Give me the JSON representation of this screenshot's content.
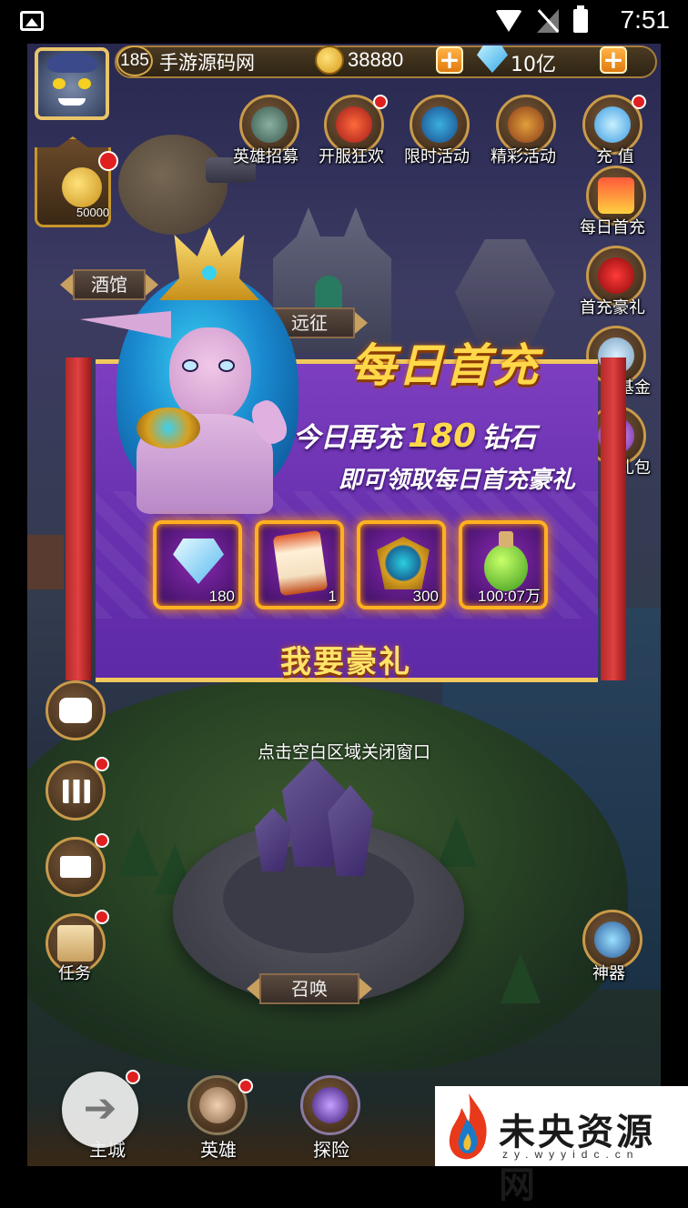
{
  "status_bar": {
    "time": "7:51",
    "icons": [
      "image-icon",
      "wifi-icon",
      "no-sim-icon",
      "battery-icon"
    ]
  },
  "player": {
    "level": "185",
    "name": "手游源码网",
    "gold": "38880",
    "diamonds": "10亿"
  },
  "top_menu": [
    {
      "label": "英雄招募",
      "icon": "hero-recruit-icon"
    },
    {
      "label": "开服狂欢",
      "icon": "server-carnival-icon"
    },
    {
      "label": "限时活动",
      "icon": "limited-event-icon"
    },
    {
      "label": "精彩活动",
      "icon": "featured-event-icon"
    },
    {
      "label": "充 值",
      "icon": "recharge-icon"
    }
  ],
  "right_menu": [
    {
      "label": "每日首充"
    },
    {
      "label": "首充豪礼"
    },
    {
      "label": "基金"
    },
    {
      "label": "礼包"
    },
    {
      "label": "神器"
    }
  ],
  "left_menu": {
    "tavern_value": "50000",
    "task_label": "任务"
  },
  "map_labels": {
    "tavern": "酒馆",
    "expedition": "远征",
    "summon": "召唤"
  },
  "popup": {
    "title": "每日首充",
    "line1_prefix": "今日再充",
    "line1_amount": "180",
    "line1_suffix": "钻石",
    "line2": "即可领取每日首充豪礼",
    "rewards": [
      {
        "icon": "diamond-icon",
        "qty": "180"
      },
      {
        "icon": "scroll-icon",
        "qty": "1"
      },
      {
        "icon": "emblem-icon",
        "qty": "300"
      },
      {
        "icon": "potion-icon",
        "qty": "100:07万"
      }
    ],
    "claim_button": "我要豪礼",
    "close_hint": "点击空白区域关闭窗口"
  },
  "bottom_nav": [
    {
      "label": "主城"
    },
    {
      "label": "英雄"
    },
    {
      "label": "探险"
    }
  ],
  "watermark": {
    "title": "未央资源网",
    "url": "zy.wyyidc.cn"
  },
  "colors": {
    "gold": "#ffd84a",
    "popup_purple": "#6a32b0",
    "notification_red": "#e02020"
  }
}
